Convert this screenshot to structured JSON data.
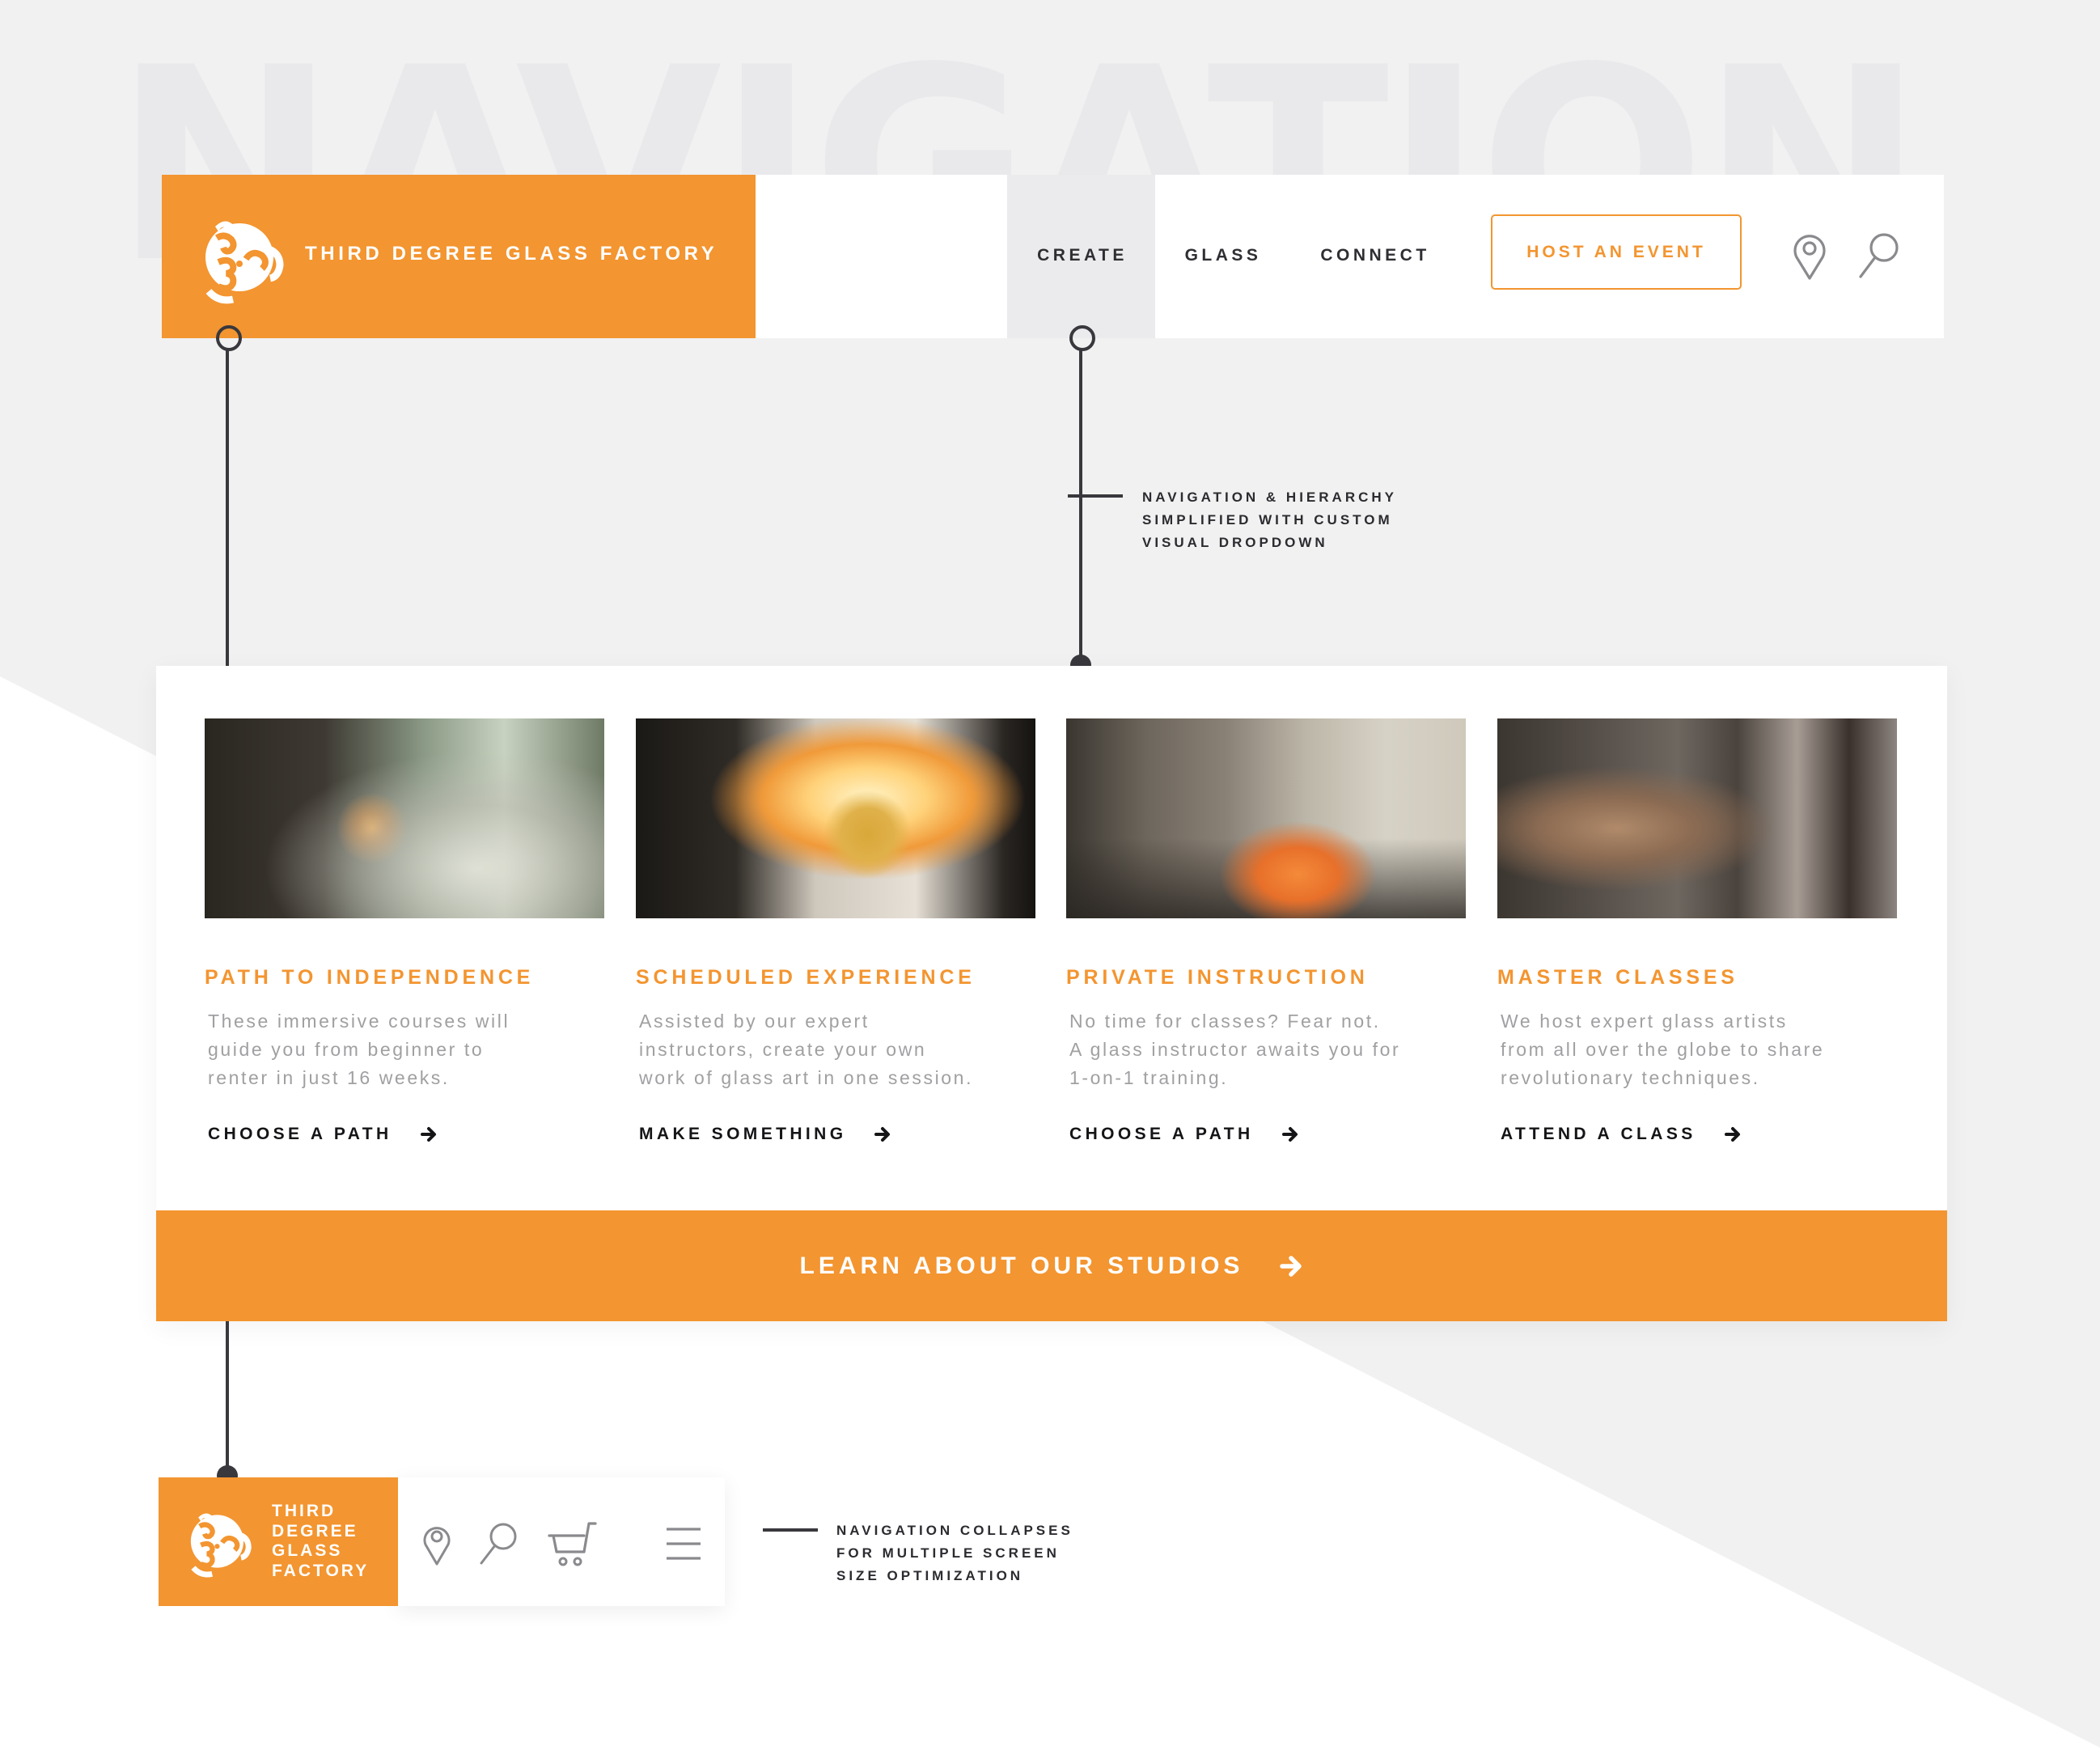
{
  "background": {
    "watermark": "NAVIGATION",
    "colors": {
      "bg": "#f1f1f1",
      "watermark": "#e9e9ec",
      "accent": "#f39530",
      "ink": "#2e2e33"
    }
  },
  "header": {
    "brand": "THIRD DEGREE GLASS FACTORY",
    "logo_icon": "3dgf-logo-icon",
    "nav": [
      {
        "label": "CREATE",
        "active": true
      },
      {
        "label": "GLASS",
        "active": false
      },
      {
        "label": "CONNECT",
        "active": false
      }
    ],
    "cta_button": "HOST AN EVENT",
    "icons": [
      "location-pin-icon",
      "search-icon"
    ]
  },
  "annotations": {
    "dropdown_note": [
      "NAVIGATION & HIERARCHY",
      "SIMPLIFIED WITH CUSTOM",
      "VISUAL DROPDOWN"
    ],
    "mobile_note": [
      "NAVIGATION COLLAPSES",
      "FOR MULTIPLE SCREEN",
      "SIZE OPTIMIZATION"
    ]
  },
  "dropdown": {
    "cards": [
      {
        "title": "PATH TO INDEPENDENCE",
        "description": "These immersive courses will\nguide you from beginner to\nrenter in just 16 weeks.",
        "link": "CHOOSE A PATH",
        "image": "glassblower-with-torch-and-clear-glass-bubble"
      },
      {
        "title": "SCHEDULED EXPERIENCE",
        "description": "Assisted by our expert\ninstructors, create your own\nwork of glass art in one session.",
        "link": "MAKE SOMETHING",
        "image": "glass-piece-in-glowing-furnace"
      },
      {
        "title": "PRIVATE INSTRUCTION",
        "description": "No time for classes? Fear not.\nA glass instructor awaits you for\n1-on-1 training.",
        "link": "CHOOSE A PATH",
        "image": "artist-holding-molten-glass-on-pipe"
      },
      {
        "title": "MASTER CLASSES",
        "description": "We host expert glass artists\nfrom all over the globe to share\nrevolutionary techniques.",
        "link": "ATTEND A CLASS",
        "image": "artist-turning-blowpipe-at-glory-hole"
      }
    ],
    "cta": "LEARN ABOUT OUR STUDIOS"
  },
  "mobile_header": {
    "brand": "THIRD\nDEGREE\nGLASS\nFACTORY",
    "icons": [
      "location-pin-icon",
      "search-icon",
      "shopping-cart-icon",
      "hamburger-menu-icon"
    ]
  }
}
